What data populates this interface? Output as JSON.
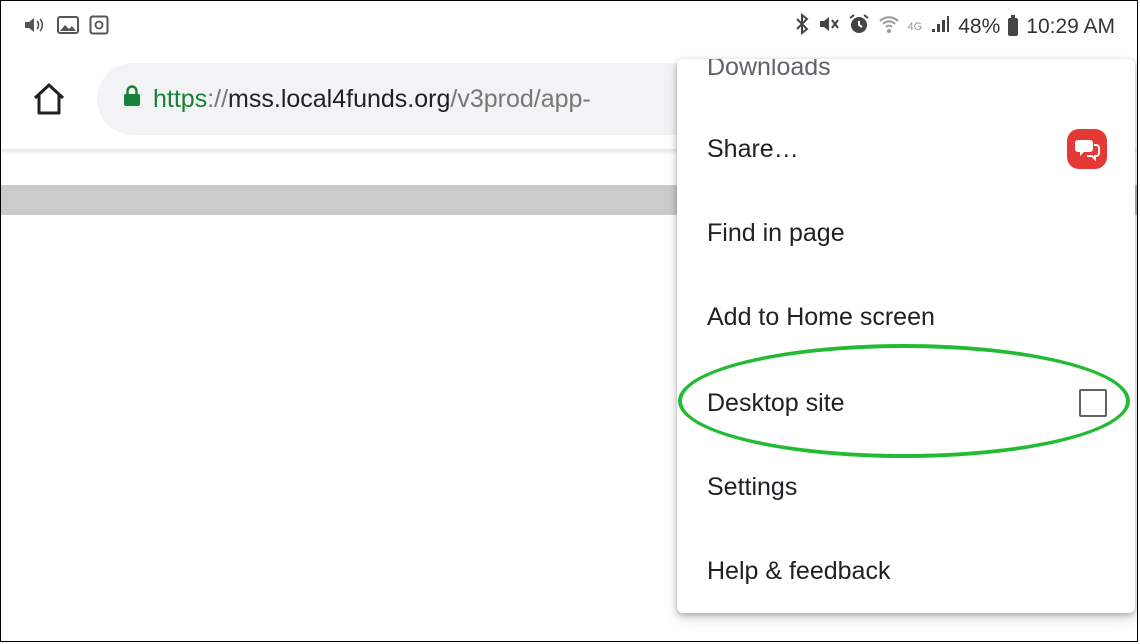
{
  "status_bar": {
    "left_icons": [
      "volume-icon",
      "image-icon",
      "screenshot-icon"
    ],
    "right_icons": [
      "bluetooth-icon",
      "mute-icon",
      "alarm-icon",
      "wifi-icon",
      "lte-icon",
      "signal-icon",
      "battery-icon"
    ],
    "lte_label": "4G",
    "battery_percent": "48%",
    "time": "10:29 AM"
  },
  "browser": {
    "url_scheme": "https",
    "url_separator": "://",
    "url_host": "mss.local4funds.org",
    "url_path": "/v3prod/app-"
  },
  "menu": {
    "items": [
      {
        "label": "Downloads"
      },
      {
        "label": "Share…",
        "icon": "share-app-icon"
      },
      {
        "label": "Find in page"
      },
      {
        "label": "Add to Home screen"
      },
      {
        "label": "Desktop site",
        "checkbox": false
      },
      {
        "label": "Settings"
      },
      {
        "label": "Help & feedback"
      }
    ]
  },
  "annotation": {
    "color": "#22bb33",
    "target": "Desktop site"
  }
}
